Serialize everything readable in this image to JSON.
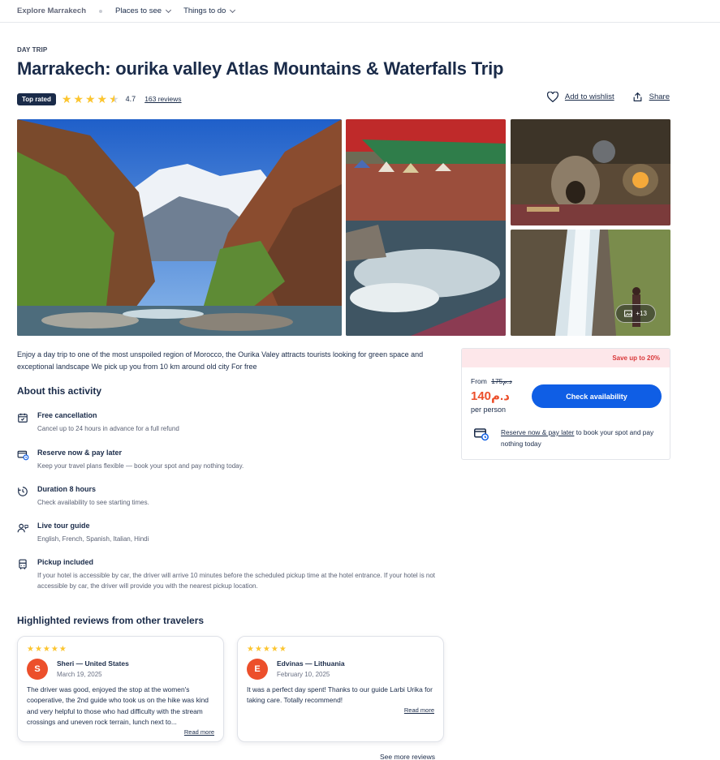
{
  "nav": {
    "breadcrumb": "Explore Marrakech",
    "menus": [
      "Places to see",
      "Things to do"
    ]
  },
  "activity": {
    "eyebrow": "DAY TRIP",
    "title": "Marrakech: ourika valley Atlas Mountains & Waterfalls Trip",
    "badge": "Top rated",
    "rating": "4.7",
    "rating_fraction": 0.94,
    "reviews_link": "163 reviews",
    "wishlist": "Add to wishlist",
    "share": "Share",
    "more_photos": "+13",
    "intro": "Enjoy a day trip to one of the most unspoiled region of Morocco, the Ourika Valey attracts tourists looking for green space and exceptional landscape We pick up you from 10 km around old city For free"
  },
  "about": {
    "heading": "About this activity",
    "features": [
      {
        "title": "Free cancellation",
        "desc": "Cancel up to 24 hours in advance for a full refund"
      },
      {
        "title": "Reserve now & pay later",
        "desc": "Keep your travel plans flexible — book your spot and pay nothing today."
      },
      {
        "title": "Duration 8 hours",
        "desc": "Check availability to see starting times."
      },
      {
        "title": "Live tour guide",
        "desc": "English, French, Spanish, Italian, Hindi"
      },
      {
        "title": "Pickup included",
        "desc": "If your hotel is accessible by car, the driver will arrive 10 minutes before the scheduled pickup time at the hotel entrance. If your hotel is not accessible by car, the driver will provide you with the nearest pickup location."
      }
    ]
  },
  "booking": {
    "save": "Save up to 20%",
    "from": "From",
    "old_price": "175د.م",
    "price": "140د.م",
    "per": "per person",
    "check": "Check availability",
    "reserve_link": "Reserve now & pay later",
    "reserve_rest": " to book your spot and pay nothing today"
  },
  "reviews": {
    "heading": "Highlighted reviews from other travelers",
    "items": [
      {
        "initial": "S",
        "name": "Sheri — United States",
        "date": "March 19, 2025",
        "stars": "★★★★★",
        "text": "The driver was good, enjoyed the stop at the women's cooperative, the 2nd guide who took us on the hike was kind and very helpful to those who had difficulty with the stream crossings and uneven rock terrain, lunch next to...",
        "more": "Read more"
      },
      {
        "initial": "E",
        "name": "Edvinas — Lithuania",
        "date": "February 10, 2025",
        "stars": "★★★★★",
        "text": "It was a perfect day spent! Thanks to our guide Larbi Urika for taking care. Totally recommend!",
        "more": "Read more"
      }
    ],
    "see_more": "See more reviews"
  },
  "colors": {
    "navy": "#1a2b49",
    "primary_blue": "#0f5ee5",
    "price_orange": "#ec4f2b",
    "star_yellow": "#fcc52f",
    "save_bg": "#fde7ea"
  }
}
